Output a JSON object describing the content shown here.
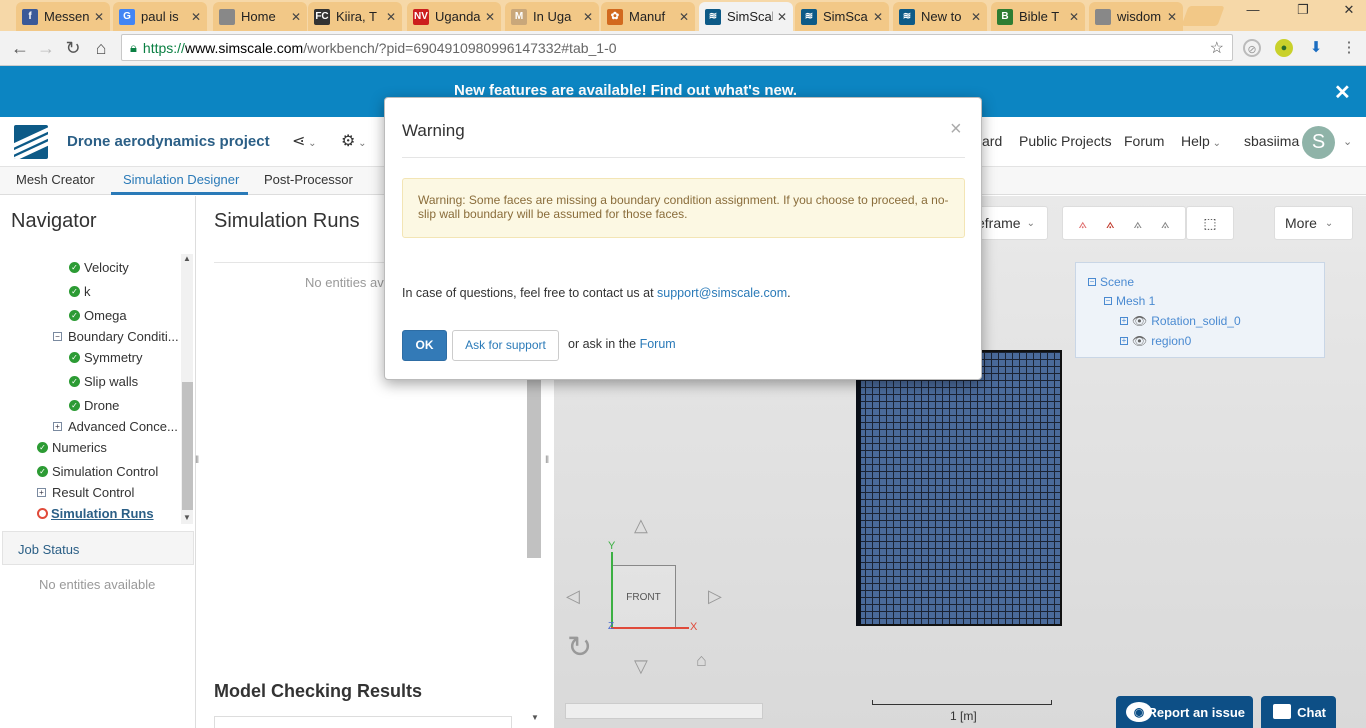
{
  "browser": {
    "tabs": [
      {
        "title": "Messenger",
        "favicon": "facebook-icon",
        "color": "#3b5998",
        "glyph": "f"
      },
      {
        "title": "paul is",
        "favicon": "google-icon",
        "color": "#4285f4",
        "glyph": "G"
      },
      {
        "title": "Home",
        "favicon": "page-icon",
        "color": "#888888",
        "glyph": ""
      },
      {
        "title": "Kiira, T",
        "favicon": "fc-icon",
        "color": "#333333",
        "glyph": "FC"
      },
      {
        "title": "Uganda",
        "favicon": "nv-icon",
        "color": "#cc1e1e",
        "glyph": "NV"
      },
      {
        "title": "In Uga",
        "favicon": "m-icon",
        "color": "#c9a77a",
        "glyph": "M"
      },
      {
        "title": "Manuf",
        "favicon": "pinwheel-icon",
        "color": "#d2691e",
        "glyph": "✿"
      },
      {
        "title": "SimScale",
        "favicon": "simscale-icon",
        "color": "#0d5a87",
        "glyph": "≋",
        "active": true
      },
      {
        "title": "SimSca",
        "favicon": "simscale-icon",
        "color": "#0d5a87",
        "glyph": "≋"
      },
      {
        "title": "New to",
        "favicon": "simscale-icon",
        "color": "#0d5a87",
        "glyph": "≋"
      },
      {
        "title": "Bible T",
        "favicon": "bible-icon",
        "color": "#2e7d32",
        "glyph": "B"
      },
      {
        "title": "wisdom",
        "favicon": "page-icon",
        "color": "#888888",
        "glyph": ""
      }
    ],
    "close_glyph": "✕",
    "url": {
      "scheme": "https://",
      "host": "www.simscale.com",
      "path": "/workbench/?pid=6904910980996147332#tab_1-0"
    },
    "window_controls": {
      "minimize": "—",
      "restore": "❐",
      "close": "✕"
    }
  },
  "banner": {
    "text": "New features are available! Find out what's new.",
    "close": "✕"
  },
  "header": {
    "project_name": "Drone aerodynamics project",
    "links": {
      "dashboard": "ard",
      "public_projects": "Public Projects",
      "forum": "Forum",
      "help": "Help"
    },
    "username": "sbasiima",
    "avatar_letter": "S"
  },
  "subtabs": [
    "Mesh Creator",
    "Simulation Designer",
    "Post-Processor"
  ],
  "navigator": {
    "title": "Navigator",
    "items": [
      {
        "label": "Velocity",
        "status": "ok"
      },
      {
        "label": "k",
        "status": "ok"
      },
      {
        "label": "Omega",
        "status": "ok"
      },
      {
        "label": "Boundary Conditi...",
        "status": "collapse"
      },
      {
        "label": "Symmetry",
        "status": "ok"
      },
      {
        "label": "Slip walls",
        "status": "ok"
      },
      {
        "label": "Drone",
        "status": "ok"
      },
      {
        "label": "Advanced Conce...",
        "status": "expand"
      },
      {
        "label": "Numerics",
        "status": "ok"
      },
      {
        "label": "Simulation Control",
        "status": "ok"
      },
      {
        "label": "Result Control",
        "status": "expand"
      },
      {
        "label": "Simulation Runs",
        "status": "pending"
      }
    ],
    "job_status_title": "Job Status",
    "job_status_empty": "No entities available"
  },
  "simulation_runs": {
    "title": "Simulation Runs",
    "empty": "No entities ava",
    "model_checking_title": "Model Checking Results"
  },
  "viewer": {
    "render_mode": "eframe",
    "more": "More",
    "scene": {
      "root": "Scene",
      "mesh": "Mesh 1",
      "children": [
        "Rotation_solid_0",
        "region0"
      ]
    },
    "cube_face": "FRONT",
    "axes": {
      "x": "X",
      "y": "Y",
      "z": "Z"
    },
    "scale_label": "1 [m]",
    "report_issue": "Report an issue",
    "chat": "Chat"
  },
  "modal": {
    "title": "Warning",
    "close": "×",
    "warning": "Warning: Some faces are missing a boundary condition assignment. If you choose to proceed, a no-slip wall boundary will be assumed for those faces.",
    "info_prefix": "In case of questions, feel free to contact us at ",
    "info_email": "support@simscale.com",
    "info_suffix": ".",
    "ok": "OK",
    "ask_support": "Ask for support",
    "or_text": "or ask in the ",
    "forum_link": "Forum"
  },
  "colors": {
    "banner": "#0c85c2",
    "accent": "#2a7ab8",
    "ok_green": "#2c9b34",
    "pending_red": "#e04a3a",
    "tab_strip": "#f6d8a8"
  }
}
